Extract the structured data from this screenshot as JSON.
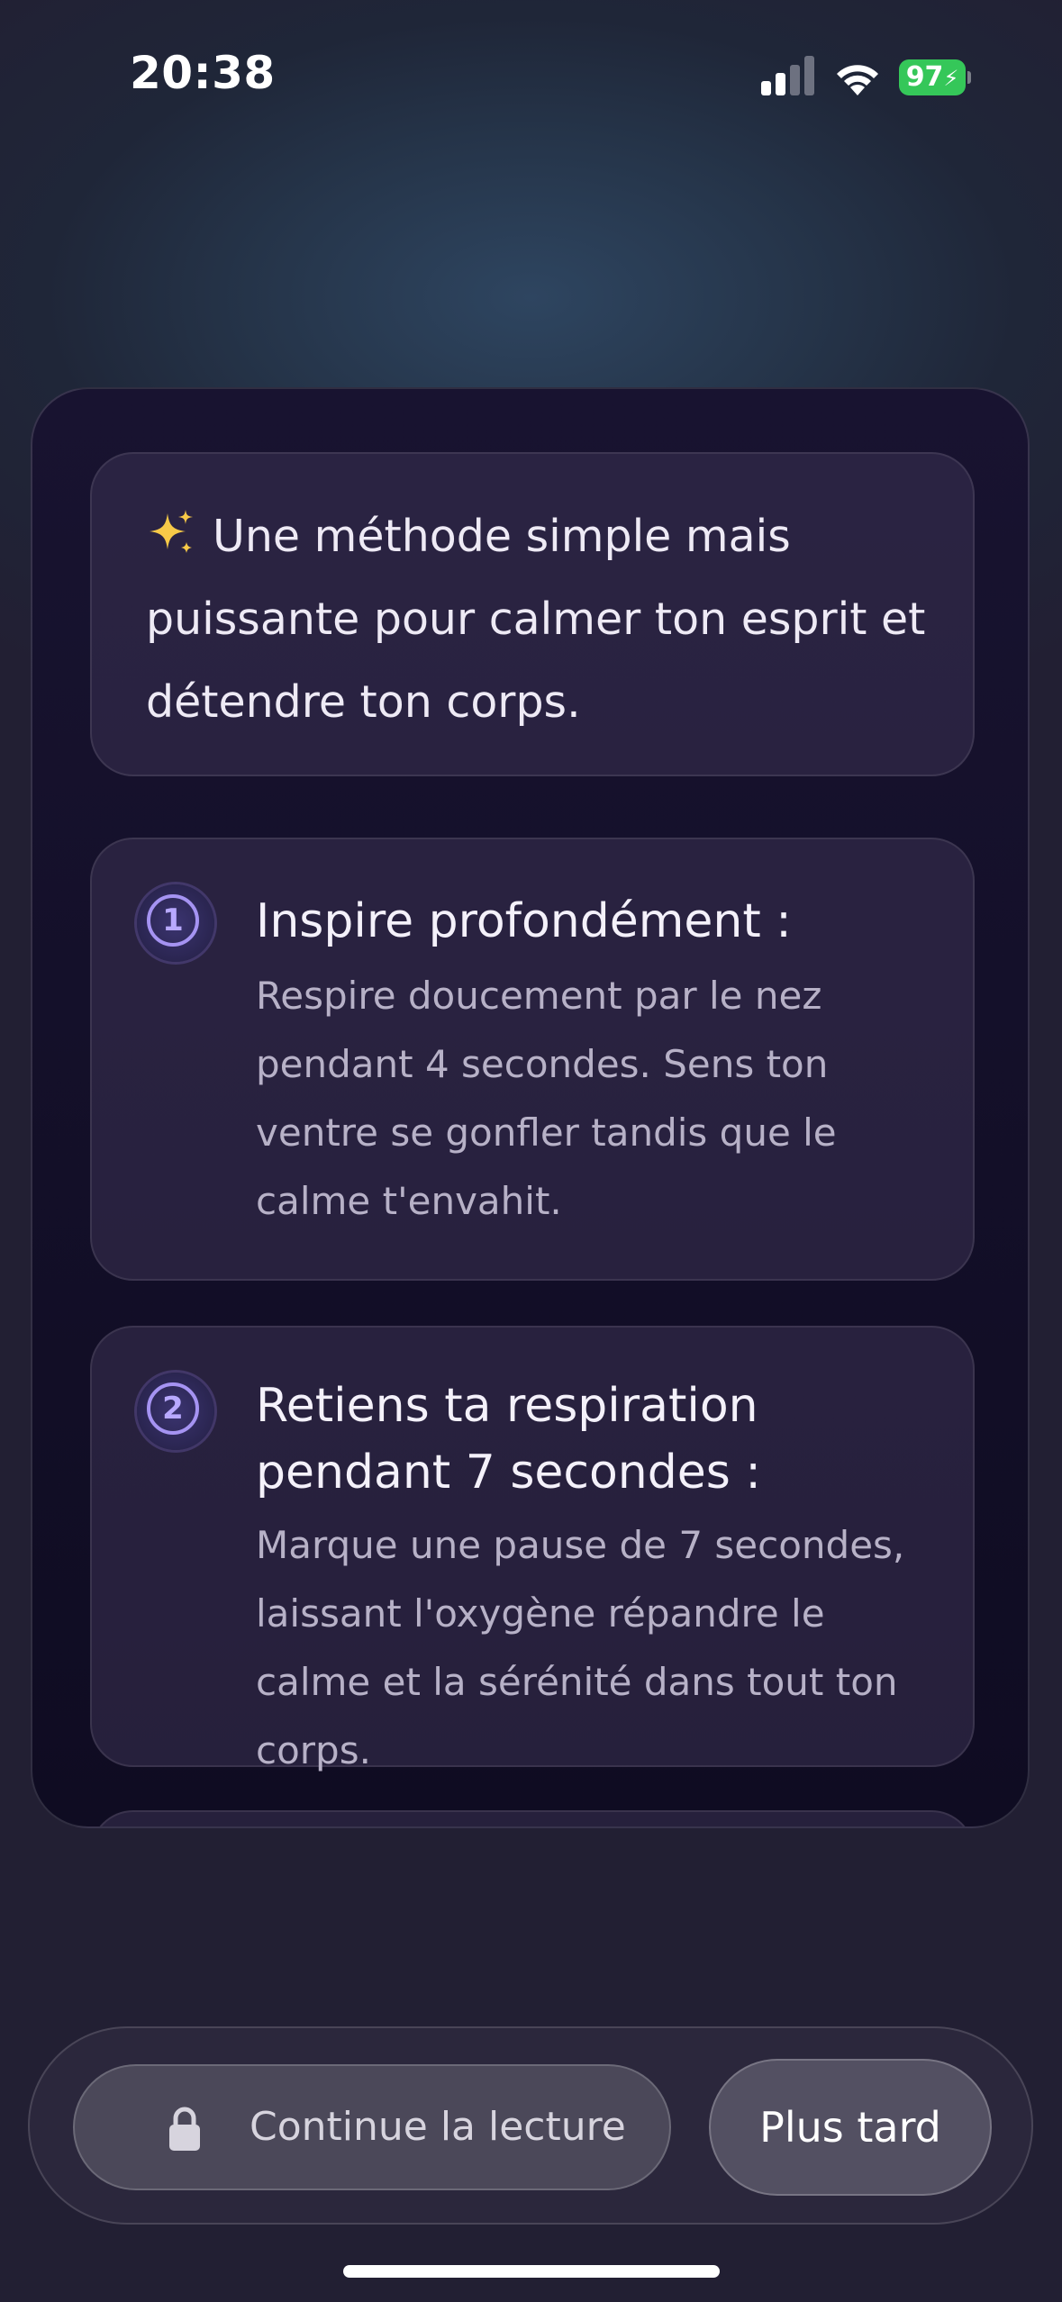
{
  "status_bar": {
    "time": "20:38",
    "battery": "97",
    "icons": [
      "signal-icon",
      "wifi-icon",
      "battery-icon",
      "charging-bolt-icon"
    ]
  },
  "intro": {
    "icon": "sparkles-icon",
    "text": "Une méthode simple mais puissante pour calmer ton esprit et détendre ton corps."
  },
  "steps": [
    {
      "number": "1",
      "title": "Inspire profondément :",
      "description": "Respire doucement par le nez pendant 4 secondes. Sens ton ventre se gonfler tandis que le calme t'envahit."
    },
    {
      "number": "2",
      "title": "Retiens ta respiration pendant 7 secondes :",
      "description": "Marque une pause de 7 secondes, laissant l'oxygène répandre le calme et la sérénité dans tout ton corps."
    }
  ],
  "actions": {
    "continue_label": "Continue la lecture",
    "continue_icon": "lock-icon",
    "later_label": "Plus tard"
  },
  "colors": {
    "accent": "#a593f2",
    "battery": "#35c759",
    "card_bg": "#151030"
  }
}
